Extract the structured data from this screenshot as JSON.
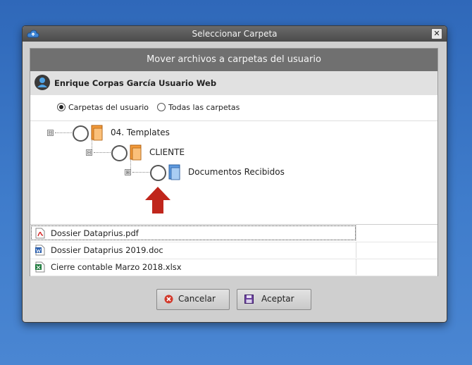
{
  "window": {
    "title": "Seleccionar Carpeta",
    "close_glyph": "✕"
  },
  "header": {
    "title": "Mover archivos a carpetas del usuario"
  },
  "user": {
    "name": "Enrique Corpas García Usuario Web",
    "icon": "user-icon"
  },
  "scope": {
    "options": [
      "Carpetas del usuario",
      "Todas las carpetas"
    ],
    "selected": "Carpetas del usuario"
  },
  "tree": {
    "nodes": [
      {
        "label": "04. Templates",
        "expander": "⊟",
        "icon": "orange-folder-icon"
      },
      {
        "label": "CLIENTE",
        "expander": "⊟",
        "icon": "orange-folder-icon"
      },
      {
        "label": "Documentos Recibidos",
        "expander": "⊞",
        "icon": "blue-folder-icon"
      }
    ]
  },
  "files": [
    {
      "name": "Dossier Dataprius.pdf",
      "icon": "pdf-icon"
    },
    {
      "name": "Dossier Dataprius 2019.doc",
      "icon": "word-icon"
    },
    {
      "name": "Cierre contable Marzo 2018.xlsx",
      "icon": "excel-icon"
    }
  ],
  "buttons": {
    "cancel": "Cancelar",
    "accept": "Aceptar"
  },
  "colors": {
    "accent_arrow": "#c0261c",
    "header_bar": "#707070"
  }
}
